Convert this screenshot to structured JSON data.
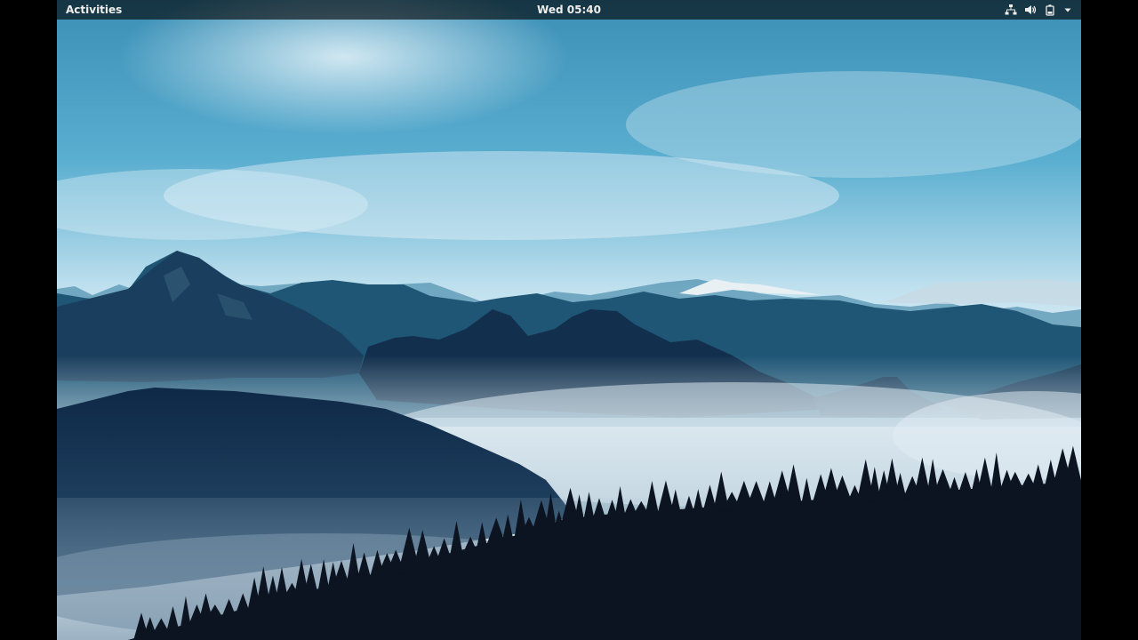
{
  "topbar": {
    "activities_label": "Activities",
    "clock": "Wed 05:40",
    "tray_icons": [
      "network-icon",
      "volume-icon",
      "battery-icon",
      "chevron-down-icon"
    ]
  },
  "desktop": {
    "wallpaper": "misty-mountains-forest",
    "colors": {
      "sky_top": "#3d97bf",
      "sky_bottom": "#e8f1f6",
      "mountain_far": "#2d6b8c",
      "mountain_mid": "#173d5c",
      "mountain_near": "#0f2a47",
      "trees": "#0b1420",
      "topbar_bg": "#000000"
    }
  }
}
